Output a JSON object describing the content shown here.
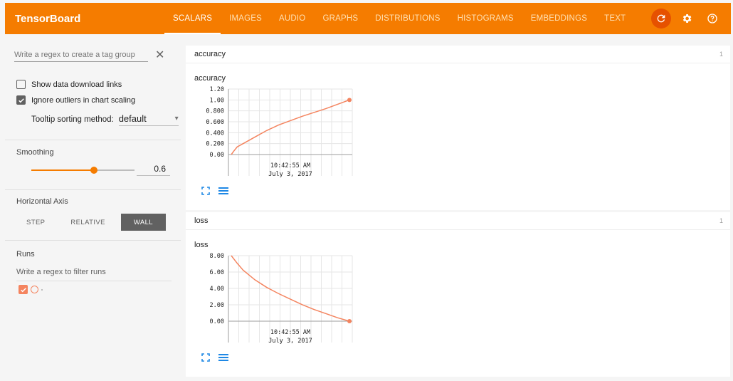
{
  "header": {
    "brand": "TensorBoard",
    "tabs": [
      "SCALARS",
      "IMAGES",
      "AUDIO",
      "GRAPHS",
      "DISTRIBUTIONS",
      "HISTOGRAMS",
      "EMBEDDINGS",
      "TEXT"
    ],
    "active_tab": "SCALARS",
    "icons": [
      "reload-icon",
      "settings-icon",
      "help-icon"
    ],
    "accent": "#f57c00"
  },
  "sidebar": {
    "tag_regex_placeholder": "Write a regex to create a tag group",
    "show_download_label": "Show data download links",
    "show_download_checked": false,
    "ignore_outliers_label": "Ignore outliers in chart scaling",
    "ignore_outliers_checked": true,
    "tooltip_label": "Tooltip sorting method:",
    "tooltip_value": "default",
    "smoothing_title": "Smoothing",
    "smoothing_value": "0.6",
    "horizontal_axis_title": "Horizontal Axis",
    "axis_options": [
      "STEP",
      "RELATIVE",
      "WALL"
    ],
    "axis_selected": "WALL",
    "runs_title": "Runs",
    "runs_filter_placeholder": "Write a regex to filter runs",
    "run_color": "#f4845f"
  },
  "cards": [
    {
      "name": "accuracy",
      "count": "1",
      "chart_data": {
        "type": "line",
        "title": "accuracy",
        "y_ticks": [
          "1.20",
          "1.00",
          "0.800",
          "0.600",
          "0.400",
          "0.200",
          "0.00"
        ],
        "x_tick_time": "10:42:55 AM",
        "x_tick_date": "July 3, 2017",
        "ylim": [
          0,
          1.2
        ],
        "x": [
          0,
          0.02,
          0.05,
          0.1,
          0.2,
          0.3,
          0.4,
          0.5,
          0.6,
          0.7,
          0.8,
          0.9,
          1.0
        ],
        "y": [
          0.0,
          0.06,
          0.14,
          0.2,
          0.32,
          0.44,
          0.54,
          0.62,
          0.7,
          0.77,
          0.84,
          0.92,
          1.0
        ],
        "color": "#f4845f",
        "grid": true
      }
    },
    {
      "name": "loss",
      "count": "1",
      "chart_data": {
        "type": "line",
        "title": "loss",
        "y_ticks": [
          "8.00",
          "6.00",
          "4.00",
          "2.00",
          "0.00"
        ],
        "x_tick_time": "10:42:55 AM",
        "x_tick_date": "July 3, 2017",
        "ylim": [
          0,
          9.5
        ],
        "x": [
          0,
          0.05,
          0.1,
          0.2,
          0.3,
          0.4,
          0.5,
          0.6,
          0.7,
          0.8,
          0.9,
          1.0
        ],
        "y": [
          9.5,
          8.4,
          7.4,
          6.0,
          4.9,
          4.0,
          3.2,
          2.4,
          1.7,
          1.1,
          0.5,
          0.0
        ],
        "color": "#f4845f",
        "grid": true
      }
    }
  ]
}
